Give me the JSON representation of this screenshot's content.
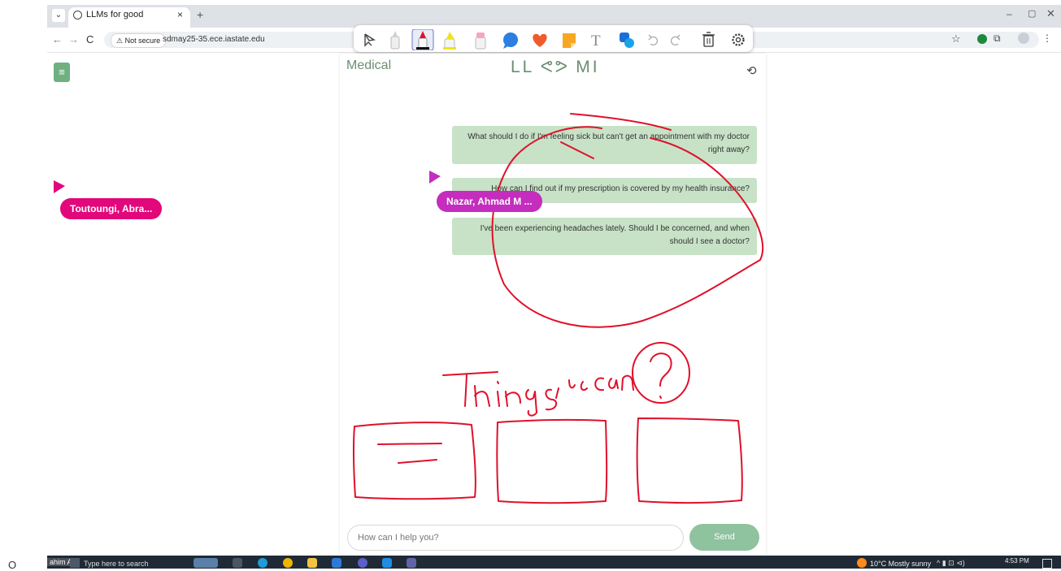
{
  "browser": {
    "tab_menu_icon": "chevron-down",
    "tab_title": "LLMs for good",
    "tab_close": "×",
    "new_tab": "+",
    "window_controls": {
      "minimize": "–",
      "maximize": "▢",
      "close": "✕"
    },
    "nav": {
      "back": "←",
      "forward": "→",
      "reload": "C"
    },
    "security_label": "⚠ Not secure",
    "url": "sdmay25-35.ece.iastate.edu",
    "star": "☆",
    "kebab": "⋮"
  },
  "annotation_toolbar": {
    "tools": [
      "pointer",
      "pen-white",
      "pen-red",
      "highlighter-yellow",
      "highlighter-pink",
      "comment",
      "heart",
      "sticky-note",
      "text",
      "shapes",
      "undo",
      "redo",
      "delete",
      "settings"
    ],
    "text_tool_label": "T",
    "accent_color": "#e0102a"
  },
  "app": {
    "menu_icon": "≡",
    "page_title": "Medical",
    "logo_text": "LL ᕙᕗ MI",
    "history_icon": "⟲",
    "messages": [
      {
        "text": "What should I do if I'm feeling sick but can't get an appointment with my doctor right away?"
      },
      {
        "text": "How can I find out if my prescription is covered by my health insurance?"
      },
      {
        "text": "I've been experiencing headaches lately. Should I be concerned, and when should I see a doctor?"
      }
    ],
    "input_placeholder": "How can I help you?",
    "send_label": "Send",
    "accent_color": "#8fc29e"
  },
  "collaborators": [
    {
      "name": "Toutoungi, Abra...",
      "color": "#e2077a"
    },
    {
      "name": "Nazar, Ahmad M ...",
      "color": "#c42dbd"
    }
  ],
  "annotations": {
    "handwritten_text": "Things u can ?",
    "ink_color": "#e0102a"
  },
  "taskbar": {
    "left_glyph": "O",
    "user": "ahim A",
    "search_text": "Type here to search",
    "weather": "10°C  Mostly sunny",
    "tray": "^  ▮  ⊡  ⊲)",
    "clock": "4:53 PM"
  }
}
